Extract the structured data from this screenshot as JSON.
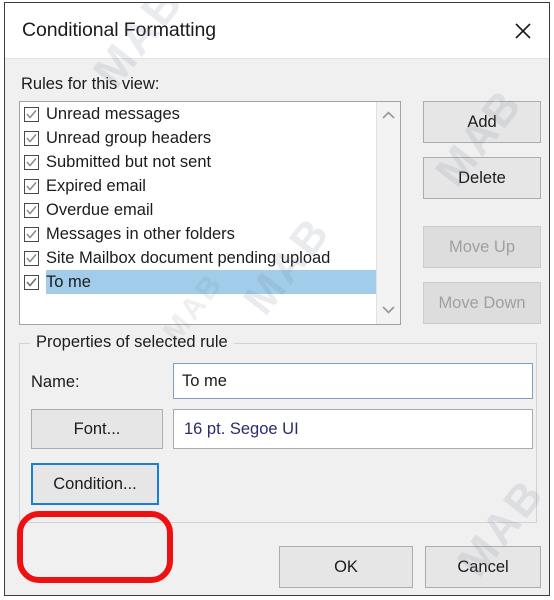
{
  "window": {
    "title": "Conditional Formatting",
    "close_icon": "close-icon"
  },
  "rules_section": {
    "label": "Rules for this view:",
    "items": [
      {
        "label": "Unread messages",
        "checked": true,
        "selected": false
      },
      {
        "label": "Unread group headers",
        "checked": true,
        "selected": false
      },
      {
        "label": "Submitted but not sent",
        "checked": true,
        "selected": false
      },
      {
        "label": "Expired email",
        "checked": true,
        "selected": false
      },
      {
        "label": "Overdue email",
        "checked": true,
        "selected": false
      },
      {
        "label": "Messages in other folders",
        "checked": true,
        "selected": false
      },
      {
        "label": "Site Mailbox document pending upload",
        "checked": true,
        "selected": false
      },
      {
        "label": "To me",
        "checked": true,
        "selected": true
      }
    ],
    "scrollbar": {
      "up_icon": "chevron-up-icon",
      "down_icon": "chevron-down-icon"
    }
  },
  "side_buttons": {
    "add": "Add",
    "delete": "Delete",
    "move_up": "Move Up",
    "move_down": "Move Down"
  },
  "properties": {
    "legend": "Properties of selected rule",
    "name_label": "Name:",
    "name_value": "To me",
    "name_placeholder": "",
    "font_button": "Font...",
    "font_preview": "16 pt. Segoe UI",
    "condition_button": "Condition..."
  },
  "footer": {
    "ok": "OK",
    "cancel": "Cancel"
  },
  "watermark": {
    "text": "MAB"
  },
  "colors": {
    "selection_blue": "#a1cdea",
    "focus_blue": "#1a7fd4",
    "annotation_red": "#ee1111",
    "font_preview_text": "#2b2b6e",
    "dialog_bg": "#f0f0f0",
    "titlebar_bg": "#ffffff"
  }
}
